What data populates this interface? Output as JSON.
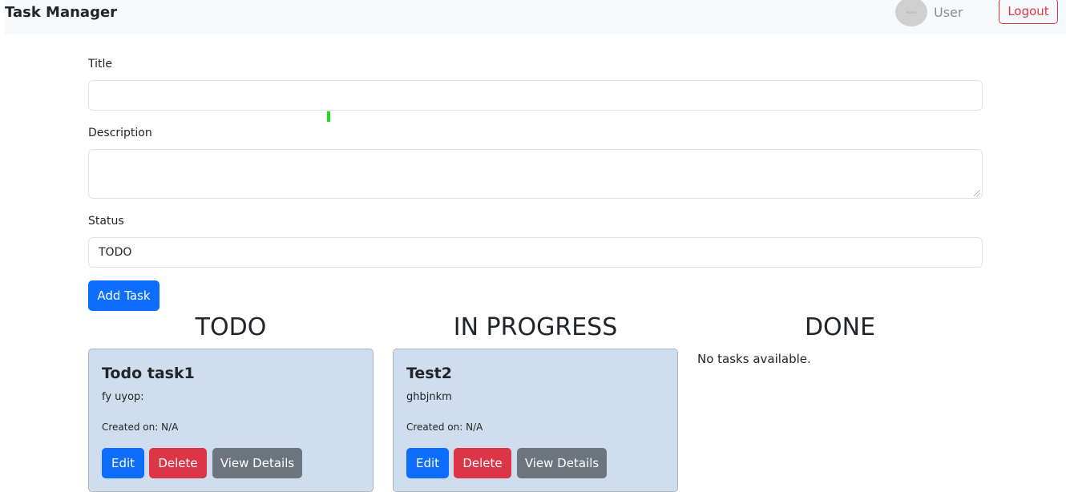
{
  "header": {
    "title": "Task Manager",
    "avatar_text": "Avatar",
    "username": "User",
    "logout_label": "Logout"
  },
  "form": {
    "title_label": "Title",
    "title_value": "",
    "description_label": "Description",
    "description_value": "",
    "status_label": "Status",
    "status_value": "TODO",
    "submit_label": "Add Task"
  },
  "columns": [
    {
      "heading": "TODO",
      "tasks": [
        {
          "title": "Todo task1",
          "description": "fy uyop:",
          "created": "Created on: N/A",
          "edit_label": "Edit",
          "delete_label": "Delete",
          "view_label": "View Details"
        }
      ]
    },
    {
      "heading": "IN PROGRESS",
      "tasks": [
        {
          "title": "Test2",
          "description": "ghbjnkm",
          "created": "Created on: N/A",
          "edit_label": "Edit",
          "delete_label": "Delete",
          "view_label": "View Details"
        }
      ]
    },
    {
      "heading": "DONE",
      "tasks": [],
      "empty_message": "No tasks available."
    }
  ],
  "colors": {
    "primary": "#0d6efd",
    "danger": "#dc3545",
    "secondary": "#6c757d",
    "card_bg": "#cfddee"
  }
}
